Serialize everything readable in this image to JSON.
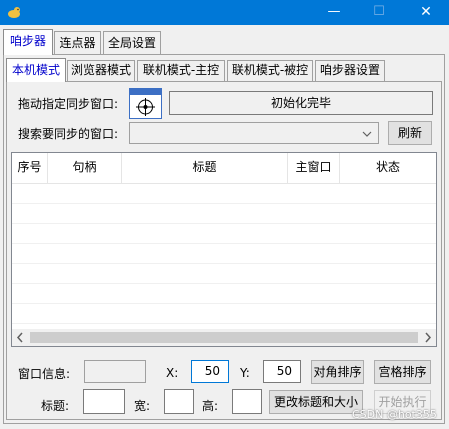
{
  "window": {
    "icon": "pet-icon",
    "controls": {
      "minimize": "—",
      "maximize": "☐",
      "close": "✕"
    }
  },
  "top_tabs": [
    "咱步器",
    "连点器",
    "全局设置"
  ],
  "sub_tabs": [
    "本机模式",
    "浏览器模式",
    "联机模式-主控",
    "联机模式-被控",
    "咱步器设置"
  ],
  "drag_label": "拖动指定同步窗口:",
  "status_text": "初始化完毕",
  "search_label": "搜索要同步的窗口:",
  "search_value": "",
  "refresh_button": "刷新",
  "table": {
    "columns": [
      "序号",
      "句柄",
      "标题",
      "主窗口",
      "状态"
    ],
    "rows": []
  },
  "window_info_label": "窗口信息:",
  "window_info_value": "",
  "x_label": "X:",
  "x_value": "50",
  "y_label": "Y:",
  "y_value": "50",
  "diagonal_button": "对角排序",
  "grid_button": "宫格排序",
  "title_label": "标题:",
  "width_label": "宽:",
  "height_label": "高:",
  "title_value": "",
  "width_value": "",
  "height_value": "",
  "change_button": "更改标题和大小",
  "start_button": "开始执行",
  "watermark": "CSDN @hot355"
}
